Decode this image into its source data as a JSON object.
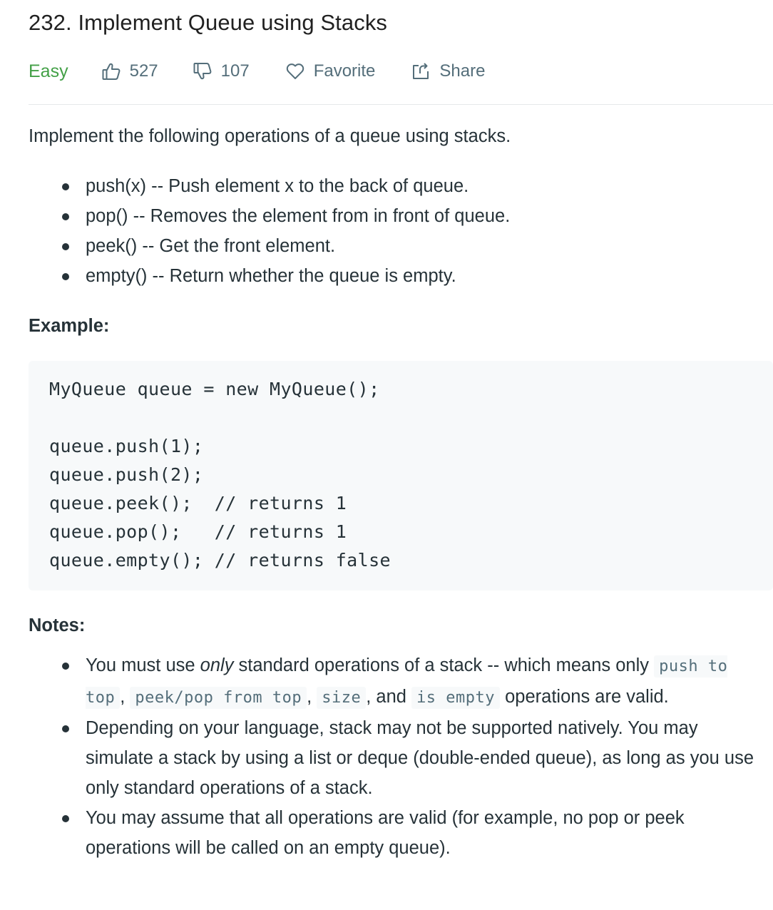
{
  "problem": {
    "title": "232. Implement Queue using Stacks",
    "difficulty": "Easy",
    "likes": "527",
    "dislikes": "107",
    "favorite_label": "Favorite",
    "share_label": "Share"
  },
  "description": {
    "intro": "Implement the following operations of a queue using stacks.",
    "operations": [
      "push(x) -- Push element x to the back of queue.",
      "pop() -- Removes the element from in front of queue.",
      "peek() -- Get the front element.",
      "empty() -- Return whether the queue is empty."
    ]
  },
  "example": {
    "heading": "Example:",
    "code_lines": [
      "MyQueue queue = new MyQueue();",
      "",
      "queue.push(1);",
      "queue.push(2);",
      "queue.peek();  // returns 1",
      "queue.pop();   // returns 1",
      "queue.empty(); // returns false"
    ]
  },
  "notes": {
    "heading": "Notes:",
    "note1": {
      "text_a": "You must use ",
      "emphasis": "only",
      "text_b": " standard operations of a stack -- which means only ",
      "code_1": "push to top",
      "sep_1": ", ",
      "code_2": "peek/pop from top",
      "sep_2": ", ",
      "code_3": "size",
      "sep_3": ", and ",
      "code_4": "is empty",
      "text_c": " operations are valid."
    },
    "note2": "Depending on your language, stack may not be supported natively. You may simulate a stack by using a list or deque (double-ended queue), as long as you use only standard operations of a stack.",
    "note3": "You may assume that all operations are valid (for example, no pop or peek operations will be called on an empty queue)."
  },
  "colors": {
    "difficulty_easy": "#43a047",
    "meta_text": "#546e7a",
    "body_text": "#263238",
    "code_background": "#f7f9fa"
  },
  "icons": [
    "thumbs-up-icon",
    "thumbs-down-icon",
    "heart-icon",
    "share-icon"
  ]
}
